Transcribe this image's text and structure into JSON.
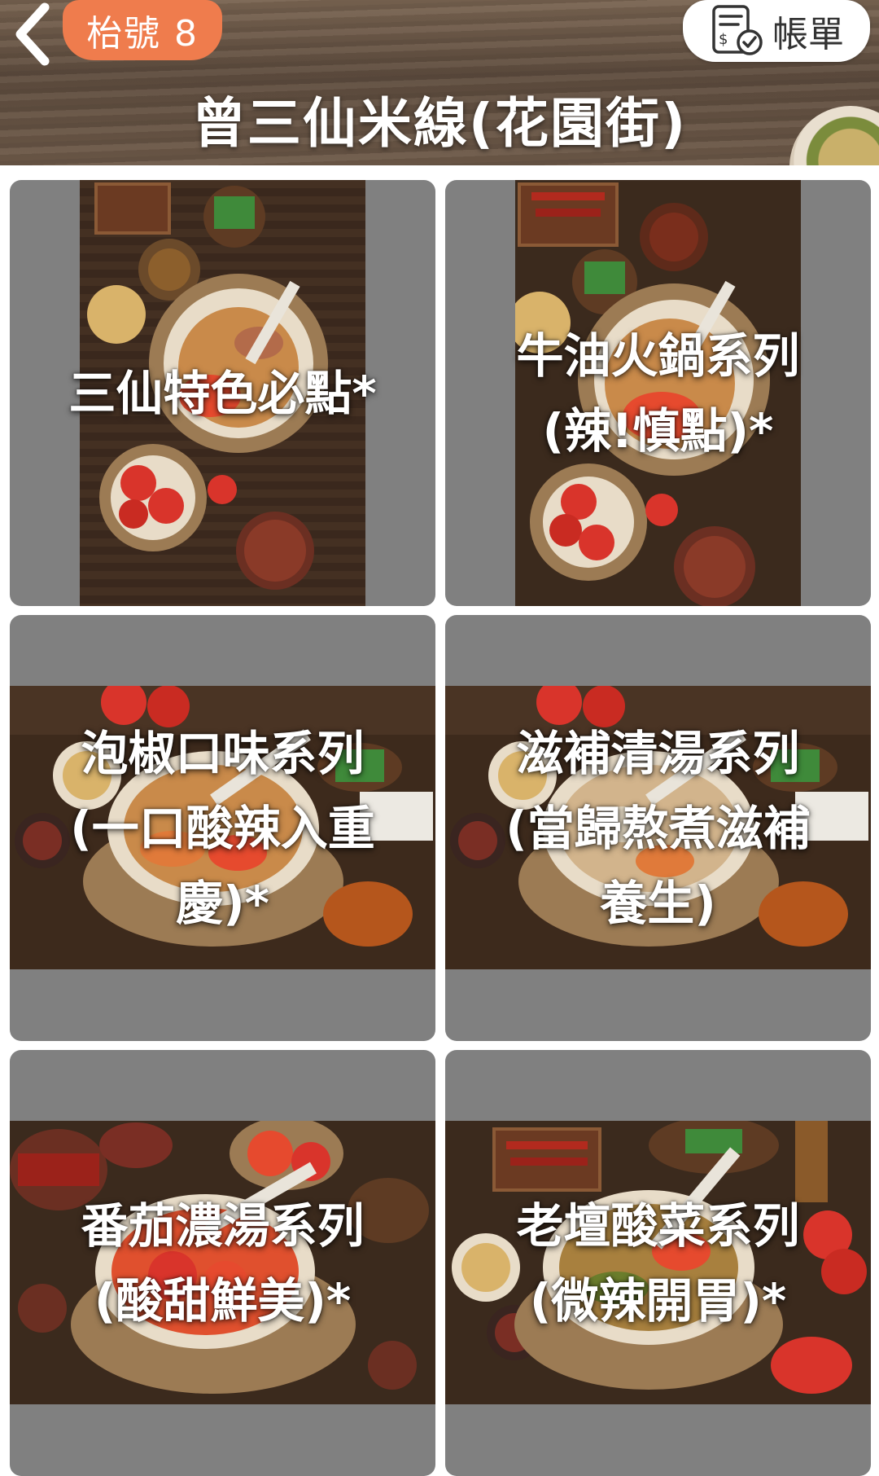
{
  "header": {
    "table_label": "枱號 8",
    "bill_label": "帳單",
    "store_title": "曾三仙米線(花園街)"
  },
  "menu": {
    "categories": [
      {
        "label": "三仙特色必點*"
      },
      {
        "label": "牛油火鍋系列\n(辣!慎點)*"
      },
      {
        "label": "泡椒口味系列\n(一口酸辣入重\n慶)*"
      },
      {
        "label": "滋補清湯系列\n(當歸熬煮滋補\n養生)"
      },
      {
        "label": "番茄濃湯系列\n(酸甜鮮美)*"
      },
      {
        "label": "老壇酸菜系列\n(微辣開胃)*"
      }
    ]
  },
  "colors": {
    "badge": "#ef7c4d",
    "card_bg": "#808080",
    "header_wood": "#6a5645"
  }
}
